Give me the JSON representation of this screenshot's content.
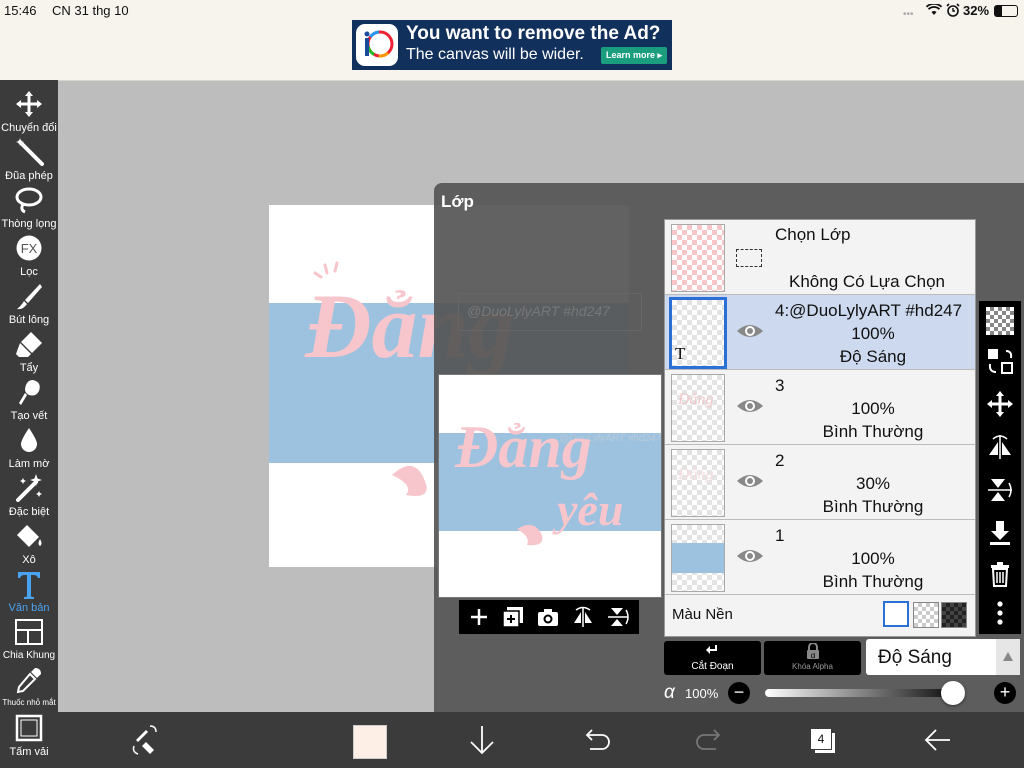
{
  "status": {
    "time": "15:46",
    "date": "CN 31 thg 10",
    "battery": "32%",
    "icons": [
      "wifi-icon",
      "alarm-icon",
      "battery-icon"
    ]
  },
  "ad": {
    "title": "You want to remove the Ad?",
    "subtitle": "The canvas will be wider.",
    "button": "Learn more"
  },
  "tools": [
    {
      "label": "Chuyển đổi",
      "icon": "move-icon"
    },
    {
      "label": "Đũa phép",
      "icon": "magic-wand-icon"
    },
    {
      "label": "Thòng lọng",
      "icon": "lasso-icon"
    },
    {
      "label": "Lọc",
      "icon": "fx-icon"
    },
    {
      "label": "Bút lông",
      "icon": "brush-icon"
    },
    {
      "label": "Tẩy",
      "icon": "eraser-icon"
    },
    {
      "label": "Tạo vết",
      "icon": "smudge-icon"
    },
    {
      "label": "Làm mờ",
      "icon": "blur-icon"
    },
    {
      "label": "Đặc biệt",
      "icon": "special-icon"
    },
    {
      "label": "Xô",
      "icon": "bucket-icon"
    },
    {
      "label": "Văn bản",
      "icon": "text-icon"
    },
    {
      "label": "Chia Khung",
      "icon": "frame-divider-icon"
    },
    {
      "label": "Thuốc nhỏ mắt",
      "icon": "eyedropper-icon"
    },
    {
      "label": "Tấm vải",
      "icon": "canvas-icon"
    }
  ],
  "canvas": {
    "lettering": "Đẳng",
    "watermark": "@DuoLylyART #hd247"
  },
  "preview": {
    "lettering1": "Đẳng",
    "lettering2": "yêu",
    "watermark": "@DuoLylyART #hd247"
  },
  "panel": {
    "title": "Lớp",
    "select_layer": {
      "title": "Chọn Lớp",
      "subtitle": "Không Có Lựa Chọn"
    },
    "layers": [
      {
        "name": "4:@DuoLylyART #hd247",
        "opacity": "100%",
        "mode": "Độ Sáng",
        "selected": true
      },
      {
        "name": "3",
        "opacity": "100%",
        "mode": "Bình Thường",
        "selected": false
      },
      {
        "name": "2",
        "opacity": "30%",
        "mode": "Bình Thường",
        "selected": false
      },
      {
        "name": "1",
        "opacity": "100%",
        "mode": "Bình Thường",
        "selected": false
      }
    ],
    "background_label": "Màu Nền",
    "clipping_label": "Cắt Đoạn",
    "alpha_lock_label": "Khóa Alpha",
    "blend_mode": "Độ Sáng",
    "alpha_symbol": "α",
    "alpha_value": "100%",
    "alpha_fraction": 1.0
  },
  "bottombar": {
    "layer_count": "4",
    "color_swatch": "#fdefe6"
  },
  "colors": {
    "accent": "#2a70d6",
    "toolbar": "#3b3b3b",
    "text_tool_active": "#4aa3f0",
    "lettering_pink": "#f7c5cc",
    "band_blue": "#9cc2df"
  }
}
